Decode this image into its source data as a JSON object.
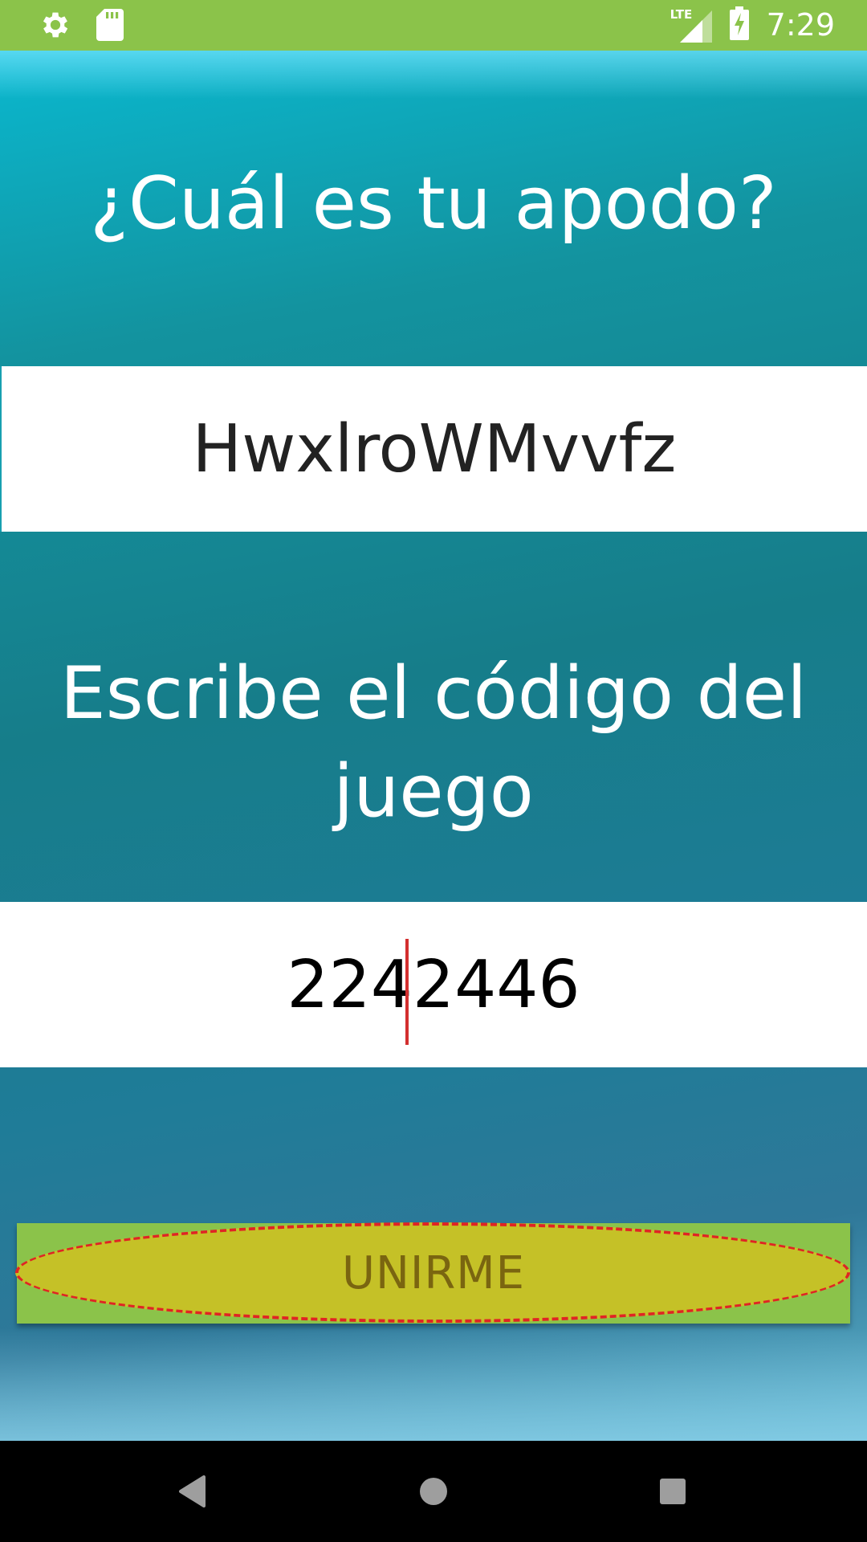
{
  "status_bar": {
    "time": "7:29",
    "network_label": "LTE",
    "icons": [
      "settings-icon",
      "sd-card-icon",
      "lte-signal-icon",
      "battery-charging-icon"
    ],
    "background_color": "#8bc34a"
  },
  "screen": {
    "nickname_prompt": "¿Cuál es tu apodo?",
    "nickname_value": "HwxlroWMvvfz",
    "code_prompt": "Escribe el código del juego",
    "code_value": "2242446",
    "join_button_label": "UNIRME"
  },
  "colors": {
    "button_green": "#8bc34a",
    "highlight_fill": "#c5c127",
    "highlight_border": "#e02424",
    "caret": "#d32f2f"
  },
  "nav_bar": {
    "icons": [
      "back-icon",
      "home-icon",
      "recents-icon"
    ]
  }
}
